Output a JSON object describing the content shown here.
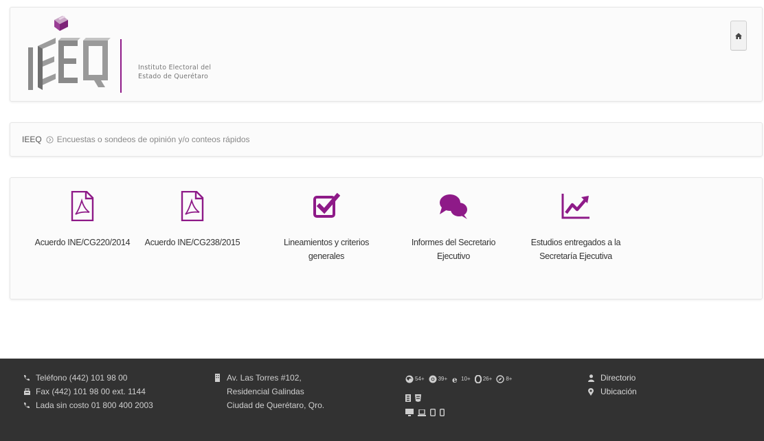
{
  "header": {
    "logo_text_line1": "Instituto Electoral del",
    "logo_text_line2": "Estado de Querétaro",
    "logo_letters": "IEEQ"
  },
  "breadcrumb": {
    "root": "IEEQ",
    "current": "Encuestas o sondeos de opinión y/o conteos rápidos"
  },
  "items": [
    {
      "label_line1": "Acuerdo INE/CG220/2014",
      "label_line2": "",
      "icon": "pdf-file-icon"
    },
    {
      "label_line1": "Acuerdo INE/CG238/2015",
      "label_line2": "",
      "icon": "pdf-file-icon"
    },
    {
      "label_line1": "Lineamientos y criterios",
      "label_line2": "generales",
      "icon": "checkbox-checked-icon"
    },
    {
      "label_line1": "Informes del Secretario",
      "label_line2": "Ejecutivo",
      "icon": "chat-bubbles-icon"
    },
    {
      "label_line1": "Estudios entregados a la",
      "label_line2": "Secretaría Ejecutiva",
      "icon": "trend-chart-icon"
    }
  ],
  "footer": {
    "phone": "Teléfono (442) 101 98 00",
    "fax": "Fax (442) 101 98 00 ext. 1144",
    "toll_free": "Lada sin costo 01 800 400 2003",
    "address_line1": "Av. Las Torres #102,",
    "address_line2": "Residencial Galindas",
    "address_line3": "Ciudad de Querétaro, Qro.",
    "browsers": [
      {
        "icon": "firefox-icon",
        "version": "54+"
      },
      {
        "icon": "chrome-icon",
        "version": "39+"
      },
      {
        "icon": "ie-icon",
        "version": "10+"
      },
      {
        "icon": "opera-icon",
        "version": "26+"
      },
      {
        "icon": "safari-icon",
        "version": "8+"
      }
    ],
    "directorio": "Directorio",
    "ubicacion": "Ubicación"
  },
  "colors": {
    "accent": "#8e1a88",
    "logo_gray": "#8a8a8a",
    "footer_bg": "#323232"
  }
}
